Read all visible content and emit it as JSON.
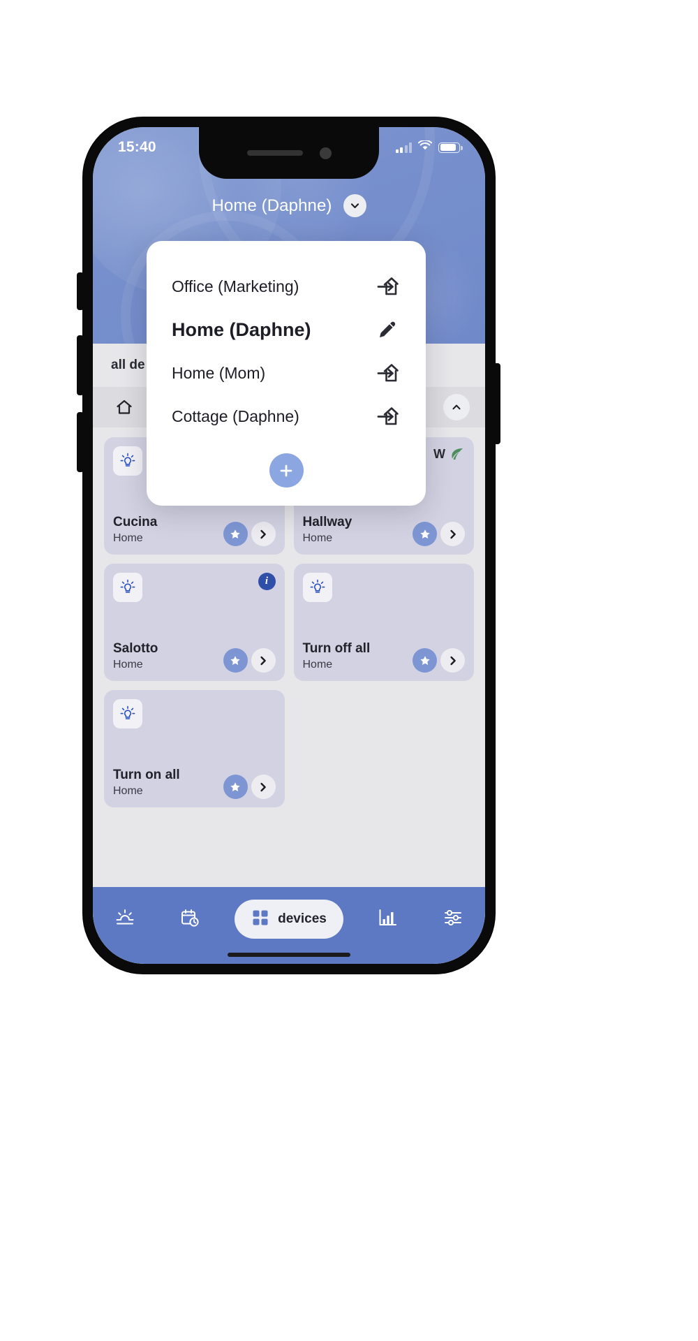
{
  "status_bar": {
    "time": "15:40",
    "signal_icon": "cellular-signal-icon",
    "wifi_icon": "wifi-icon",
    "battery_icon": "battery-icon"
  },
  "header": {
    "home_title": "Home (Daphne)",
    "chevron_icon": "chevron-down-icon"
  },
  "tabs": [
    {
      "label": "all de",
      "active": true
    }
  ],
  "filter_bar": {
    "home_icon": "home-icon",
    "collapse_icon": "chevron-up-icon"
  },
  "modal": {
    "items": [
      {
        "label": "Office (Marketing)",
        "icon": "home-switch-icon",
        "current": false
      },
      {
        "label": "Home (Daphne)",
        "icon": "pencil-edit-icon",
        "current": true
      },
      {
        "label": "Home (Mom)",
        "icon": "home-switch-icon",
        "current": false
      },
      {
        "label": "Cottage (Daphne)",
        "icon": "home-switch-icon",
        "current": false
      }
    ],
    "add_label": "+",
    "add_icon": "plus-icon"
  },
  "cards": [
    {
      "name": "Cucina",
      "sub": "Home",
      "tile_icon": "lightbulb-icon",
      "badge": null,
      "info": false,
      "fav_icon": "star-icon",
      "go_icon": "chevron-right-icon"
    },
    {
      "name": "Hallway",
      "sub": "Home",
      "tile_icon": "lightbulb-icon",
      "badge": "W",
      "info": false,
      "leaf": "leaf-icon",
      "fav_icon": "star-icon",
      "go_icon": "chevron-right-icon"
    },
    {
      "name": "Salotto",
      "sub": "Home",
      "tile_icon": "lightbulb-icon",
      "badge": null,
      "info": true,
      "info_icon": "info-icon",
      "fav_icon": "star-icon",
      "go_icon": "chevron-right-icon"
    },
    {
      "name": "Turn off all",
      "sub": "Home",
      "tile_icon": "lightbulb-icon",
      "badge": null,
      "info": false,
      "fav_icon": "star-icon",
      "go_icon": "chevron-right-icon"
    },
    {
      "name": "Turn on all",
      "sub": "Home",
      "tile_icon": "lightbulb-icon",
      "badge": null,
      "info": false,
      "fav_icon": "star-icon",
      "go_icon": "chevron-right-icon"
    }
  ],
  "bottom_nav": {
    "items": [
      {
        "icon": "weather-sun-icon",
        "label": "",
        "active": false
      },
      {
        "icon": "calendar-clock-icon",
        "label": "",
        "active": false
      },
      {
        "icon": "devices-grid-icon",
        "label": "devices",
        "active": true
      },
      {
        "icon": "statistics-bars-icon",
        "label": "",
        "active": false
      },
      {
        "icon": "sliders-settings-icon",
        "label": "",
        "active": false
      }
    ]
  },
  "colors": {
    "accent": "#7d96d3",
    "nav_bg": "#5d79c4",
    "card_bg": "#d2d2e2",
    "sheet_bg": "#e7e7ea",
    "info_blue": "#2f4fa8",
    "add_btn": "#8ba6e0"
  }
}
